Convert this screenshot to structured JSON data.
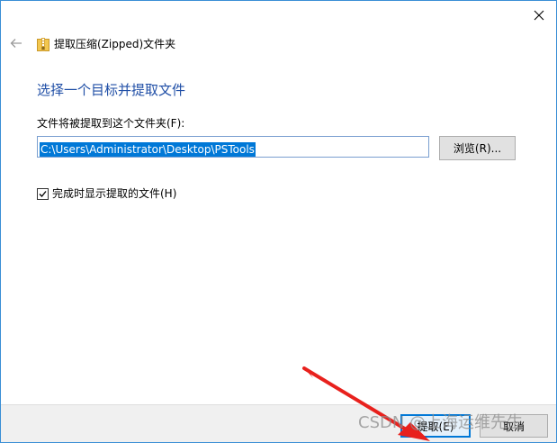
{
  "window": {
    "title": "提取压缩(Zipped)文件夹",
    "close_icon": "close-icon",
    "back_icon": "back-arrow-icon"
  },
  "main": {
    "heading": "选择一个目标并提取文件",
    "field_label": "文件将被提取到这个文件夹(F):",
    "path_value": "C:\\Users\\Administrator\\Desktop\\PSTools",
    "browse_label": "浏览(R)...",
    "checkbox_label": "完成时显示提取的文件(H)",
    "checkbox_checked": true
  },
  "footer": {
    "extract_label": "提取(E)",
    "cancel_label": "取消"
  },
  "overlay": {
    "watermark": "CSDN @上海运维先生",
    "arrow_color": "#e8211d"
  },
  "colors": {
    "heading": "#1f4ea6",
    "selection": "#0078d7",
    "window_border": "#3a8fd6"
  }
}
